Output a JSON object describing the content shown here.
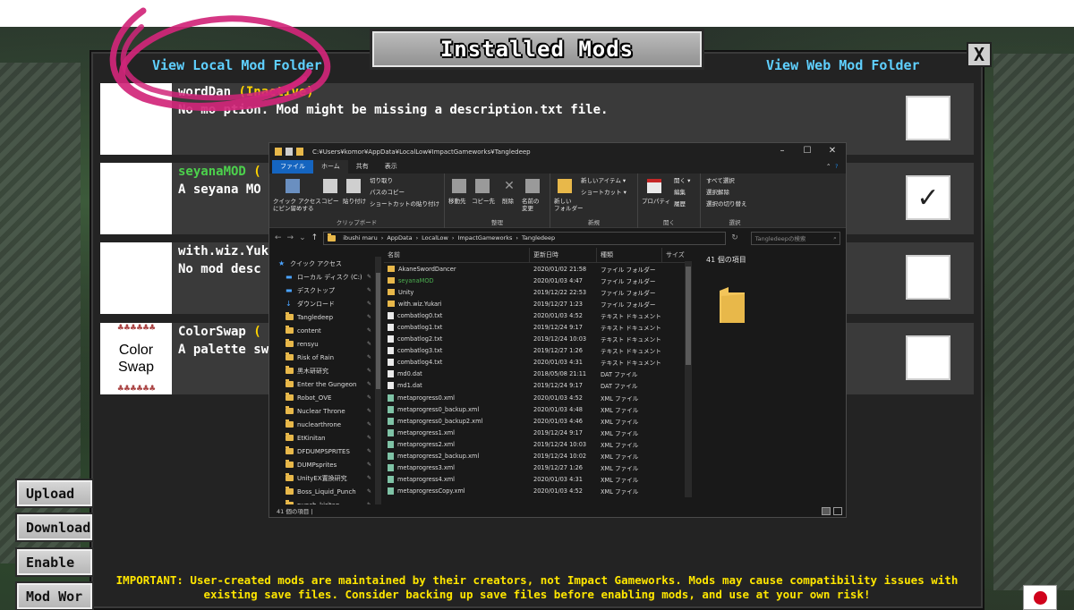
{
  "panel": {
    "title": "Installed Mods",
    "close_label": "X",
    "view_local": "View Local Mod Folder",
    "view_web": "View Web Mod Folder",
    "important": "IMPORTANT: User-created mods are maintained by their creators, not Impact Gameworks. Mods may cause compatibility issues with existing save files. Consider backing up save files before enabling mods, and use at your own risk!",
    "side_buttons": [
      "Upload",
      "Download",
      "Enable",
      "Mod Wor"
    ]
  },
  "mods": [
    {
      "name": "AkaneSwordDancer",
      "status": "(Inactive)",
      "name_visible": "wordDan",
      "status_visible": "Inactive)",
      "desc": "No mod description. Mod might be missing a description.txt file.",
      "desc_visible": "No mo        ption. Mod might be missing a description.txt file.",
      "checked": false
    },
    {
      "name": "seyanaMOD",
      "status_visible": "(",
      "name_visible": "seyanaMOD",
      "desc_visible": "A seyana MO",
      "checked": true
    },
    {
      "name": "with.wiz.Yukari",
      "name_visible": "with.wiz.Yuk",
      "desc_visible": "No mod desc",
      "checked": false
    },
    {
      "name": "ColorSwap",
      "name_visible": "ColorSwap",
      "status_visible": "(",
      "desc_visible": "A palette sw",
      "checked": false,
      "thumb_line1": "Color",
      "thumb_line2": "Swap"
    }
  ],
  "explorer": {
    "title_path": "C:¥Users¥komor¥AppData¥LocalLow¥ImpactGameworks¥Tangledeep",
    "tabs": [
      "ファイル",
      "ホーム",
      "共有",
      "表示"
    ],
    "ribbon": {
      "pin": "クイック アクセス\nにピン留めする",
      "copy": "コピー",
      "paste": "貼り付け",
      "cut": "切り取り",
      "copy_path": "パスのコピー",
      "paste_shortcut": "ショートカットの貼り付け",
      "clipboard": "クリップボード",
      "move_to": "移動先",
      "copy_to": "コピー先",
      "delete": "削除",
      "rename": "名前の\n変更",
      "organize": "整理",
      "new_folder": "新しい\nフォルダー",
      "new_item": "新しいアイテム ▾",
      "shortcut": "ショートカット ▾",
      "new": "新規",
      "properties": "プロパティ",
      "open": "開く ▾",
      "edit": "編集",
      "history": "履歴",
      "open_group": "開く",
      "select_all": "すべて選択",
      "select_none": "選択解除",
      "invert": "選択の切り替え",
      "select": "選択"
    },
    "breadcrumb": [
      "ibushi maru",
      "AppData",
      "LocalLow",
      "ImpactGameworks",
      "Tangledeep"
    ],
    "search_placeholder": "Tangledeepの検索",
    "nav_items": [
      {
        "label": "クイック アクセス",
        "icon": "star-icon"
      },
      {
        "label": "ローカル ディスク (C:)",
        "icon": "drive-icon"
      },
      {
        "label": "デスクトップ",
        "icon": "desktop-icon"
      },
      {
        "label": "ダウンロード",
        "icon": "download-icon"
      },
      {
        "label": "Tangledeep",
        "icon": "folder-icon"
      },
      {
        "label": "content",
        "icon": "folder-icon"
      },
      {
        "label": "rensyu",
        "icon": "folder-icon"
      },
      {
        "label": "Risk of Rain",
        "icon": "folder-icon"
      },
      {
        "label": "黒木研研究",
        "icon": "folder-icon"
      },
      {
        "label": "Enter the Gungeon",
        "icon": "folder-icon"
      },
      {
        "label": "Robot_OVE",
        "icon": "folder-icon"
      },
      {
        "label": "Nuclear Throne",
        "icon": "folder-icon"
      },
      {
        "label": "nuclearthrone",
        "icon": "folder-icon"
      },
      {
        "label": "EtKinitan",
        "icon": "folder-icon"
      },
      {
        "label": "DFDUMPSPRITES",
        "icon": "folder-icon"
      },
      {
        "label": "DUMPsprites",
        "icon": "folder-icon"
      },
      {
        "label": "UnityEX置換研究",
        "icon": "folder-icon"
      },
      {
        "label": "Boss_Liquid_Punch",
        "icon": "folder-icon"
      },
      {
        "label": "punch_kiritan",
        "icon": "folder-icon"
      }
    ],
    "columns": {
      "name": "名前",
      "date": "更新日時",
      "type": "種類",
      "size": "サイズ"
    },
    "files": [
      {
        "name": "AkaneSwordDancer",
        "date": "2020/01/02 21:58",
        "type": "ファイル フォルダー",
        "kind": "folder"
      },
      {
        "name": "seyanaMOD",
        "date": "2020/01/03 4:47",
        "type": "ファイル フォルダー",
        "kind": "folder"
      },
      {
        "name": "Unity",
        "date": "2019/12/22 22:53",
        "type": "ファイル フォルダー",
        "kind": "folder"
      },
      {
        "name": "with.wiz.Yukari",
        "date": "2019/12/27 1:23",
        "type": "ファイル フォルダー",
        "kind": "folder"
      },
      {
        "name": "combatlog0.txt",
        "date": "2020/01/03 4:52",
        "type": "テキスト ドキュメント",
        "kind": "txt"
      },
      {
        "name": "combatlog1.txt",
        "date": "2019/12/24 9:17",
        "type": "テキスト ドキュメント",
        "kind": "txt"
      },
      {
        "name": "combatlog2.txt",
        "date": "2019/12/24 10:03",
        "type": "テキスト ドキュメント",
        "kind": "txt"
      },
      {
        "name": "combatlog3.txt",
        "date": "2019/12/27 1:26",
        "type": "テキスト ドキュメント",
        "kind": "txt"
      },
      {
        "name": "combatlog4.txt",
        "date": "2020/01/03 4:31",
        "type": "テキスト ドキュメント",
        "kind": "txt"
      },
      {
        "name": "md0.dat",
        "date": "2018/05/08 21:11",
        "type": "DAT ファイル",
        "kind": "dat"
      },
      {
        "name": "md1.dat",
        "date": "2019/12/24 9:17",
        "type": "DAT ファイル",
        "kind": "dat"
      },
      {
        "name": "metaprogress0.xml",
        "date": "2020/01/03 4:52",
        "type": "XML ファイル",
        "kind": "xml"
      },
      {
        "name": "metaprogress0_backup.xml",
        "date": "2020/01/03 4:48",
        "type": "XML ファイル",
        "kind": "xml"
      },
      {
        "name": "metaprogress0_backup2.xml",
        "date": "2020/01/03 4:46",
        "type": "XML ファイル",
        "kind": "xml"
      },
      {
        "name": "metaprogress1.xml",
        "date": "2019/12/24 9:17",
        "type": "XML ファイル",
        "kind": "xml"
      },
      {
        "name": "metaprogress2.xml",
        "date": "2019/12/24 10:03",
        "type": "XML ファイル",
        "kind": "xml"
      },
      {
        "name": "metaprogress2_backup.xml",
        "date": "2019/12/24 10:02",
        "type": "XML ファイル",
        "kind": "xml"
      },
      {
        "name": "metaprogress3.xml",
        "date": "2019/12/27 1:26",
        "type": "XML ファイル",
        "kind": "xml"
      },
      {
        "name": "metaprogress4.xml",
        "date": "2020/01/03 4:31",
        "type": "XML ファイル",
        "kind": "xml"
      },
      {
        "name": "metaprogressCopy.xml",
        "date": "2020/01/03 4:52",
        "type": "XML ファイル",
        "kind": "xml"
      }
    ],
    "item_count": "41 個の項目",
    "status_text": "41 個の項目  |",
    "colors": {
      "selected_green": "#4caf50",
      "file_tab": "#1565c0"
    }
  },
  "annotation": {
    "color": "#d1267a"
  }
}
